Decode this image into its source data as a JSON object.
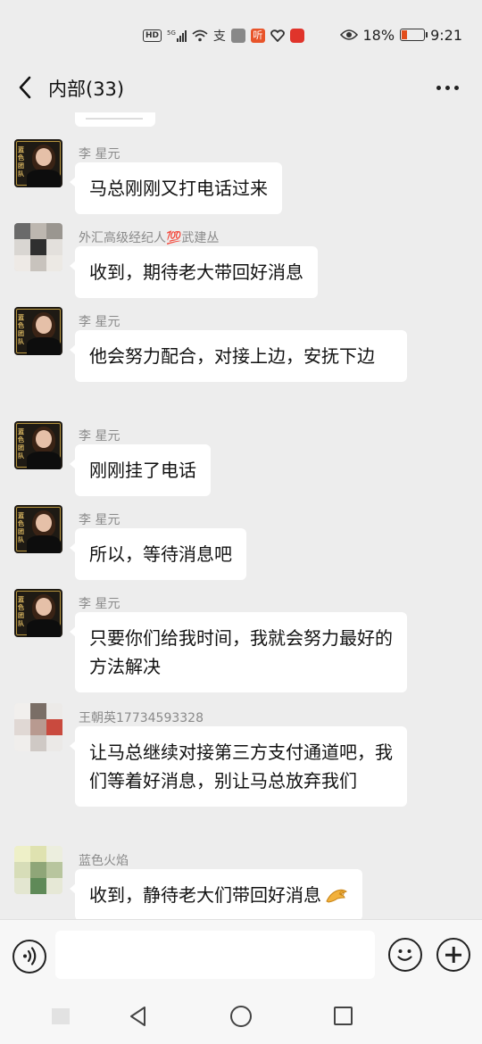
{
  "status_bar": {
    "network_badge": "HD",
    "signal_label": "5G",
    "alipay_glyph": "支",
    "app_badge": "听",
    "battery_percent": "18%",
    "time": "9:21"
  },
  "header": {
    "title": "内部(33)"
  },
  "messages": [
    {
      "sender": "李 星元",
      "text": "马总刚刚又打电话过来",
      "avatar": "lee"
    },
    {
      "sender": "外汇高级经纪人💯武建丛",
      "text": "收到，期待老大带回好消息",
      "avatar": "blurred"
    },
    {
      "sender": "李 星元",
      "text": "他会努力配合，对接上边，安抚下边",
      "avatar": "lee"
    },
    {
      "sender": "李 星元",
      "text": "刚刚挂了电话",
      "avatar": "lee"
    },
    {
      "sender": "李 星元",
      "text": "所以，等待消息吧",
      "avatar": "lee"
    },
    {
      "sender": "李 星元",
      "text": "只要你们给我时间，我就会努力最好的方法解决",
      "avatar": "lee"
    },
    {
      "sender": "王朝英17734593328",
      "text": "让马总继续对接第三方支付通道吧，我们等着好消息，别让马总放弃我们",
      "avatar": "blurred"
    },
    {
      "sender": "蓝色火焰",
      "text": "收到，静待老大们带回好消息",
      "emoji": "ok-hand",
      "avatar": "blurred"
    }
  ],
  "avatar_seal_text": "蓝色团队",
  "input": {
    "value": "",
    "placeholder": ""
  },
  "colors": {
    "background": "#ededed",
    "bubble": "#ffffff",
    "sender_name": "#8a8a8a",
    "battery_low": "#e24d1c"
  }
}
